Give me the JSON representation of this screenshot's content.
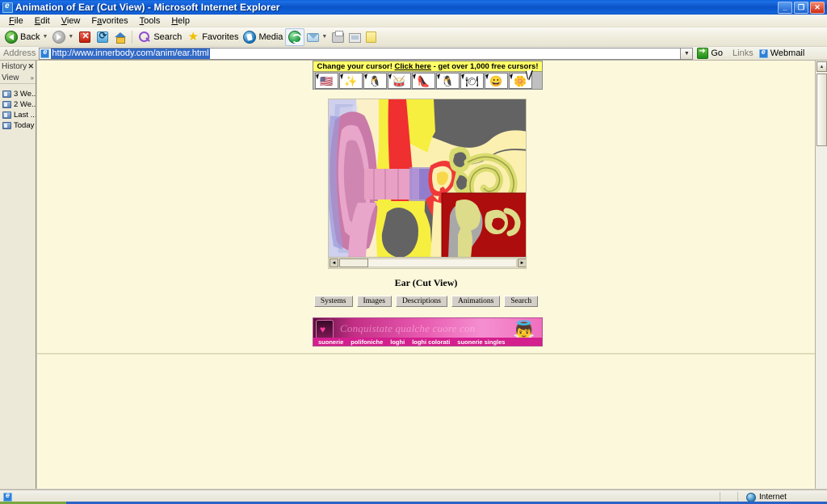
{
  "window": {
    "title": "Animation of Ear (Cut View) - Microsoft Internet Explorer",
    "icon": "ie-logo-icon",
    "minimize_label": "_",
    "maximize_label": "❐",
    "close_label": "✕"
  },
  "menubar": {
    "items": [
      {
        "label": "File",
        "accel": "F"
      },
      {
        "label": "Edit",
        "accel": "E"
      },
      {
        "label": "View",
        "accel": "V"
      },
      {
        "label": "Favorites",
        "accel": "a"
      },
      {
        "label": "Tools",
        "accel": "T"
      },
      {
        "label": "Help",
        "accel": "H"
      }
    ]
  },
  "toolbar": {
    "back_label": "Back",
    "search_label": "Search",
    "favorites_label": "Favorites",
    "media_label": "Media",
    "dropdown_arrow": "▼"
  },
  "address": {
    "label": "Address",
    "url": "http://www.innerbody.com/anim/ear.html",
    "placeholder": "Address",
    "dropdown_arrow": "▼",
    "go_label": "Go",
    "links_label": "Links",
    "webmail_label": "Webmail"
  },
  "sidebar": {
    "title": "History",
    "close_label": "✕",
    "view_label": "View",
    "view_dot": "·",
    "view_chevron": "»",
    "items": [
      {
        "label": "3 We..."
      },
      {
        "label": "2 We..."
      },
      {
        "label": "Last ..."
      },
      {
        "label": "Today"
      }
    ]
  },
  "page": {
    "background_color": "#fbf8dc",
    "cursor_ad": {
      "headline_prefix": "Change your cursor!",
      "headline_link": "Click here",
      "headline_suffix": "- get over 1,000 free cursors!",
      "icons": [
        {
          "name": "us-flag-cursor-icon",
          "glyph": "🇺🇸"
        },
        {
          "name": "starburst-cursor-icon",
          "glyph": "✨"
        },
        {
          "name": "penguin-cursor-icon",
          "glyph": "🐧"
        },
        {
          "name": "drum-cursor-icon",
          "glyph": "🥁"
        },
        {
          "name": "red-shoes-cursor-icon",
          "glyph": "👠"
        },
        {
          "name": "penguin-two-cursor-icon",
          "glyph": "🐧"
        },
        {
          "name": "bird-dish-cursor-icon",
          "glyph": "🍽"
        },
        {
          "name": "smiley-face-cursor-icon",
          "glyph": "😀"
        },
        {
          "name": "flower-cursor-icon",
          "glyph": "🌼"
        }
      ]
    },
    "animation": {
      "alt": "Ear cut view anatomical animation",
      "scroll_left_label": "◄",
      "scroll_right_label": "►"
    },
    "caption": "Ear (Cut View)",
    "nav_buttons": [
      {
        "label": "Systems"
      },
      {
        "label": "Images"
      },
      {
        "label": "Descriptions"
      },
      {
        "label": "Animations"
      },
      {
        "label": "Search"
      }
    ],
    "pink_ad": {
      "tagline": "Conquistate qualche cuore con",
      "links": [
        {
          "label": "suonerie"
        },
        {
          "label": "polifoniche"
        },
        {
          "label": "loghi"
        },
        {
          "label": "loghi colorati"
        },
        {
          "label": "suonerie singles"
        }
      ]
    },
    "scrollbar": {
      "up_label": "▲",
      "down_label": "▼"
    }
  },
  "statusbar": {
    "message": "",
    "zone_label": "Internet",
    "zone_icon": "globe-icon"
  }
}
